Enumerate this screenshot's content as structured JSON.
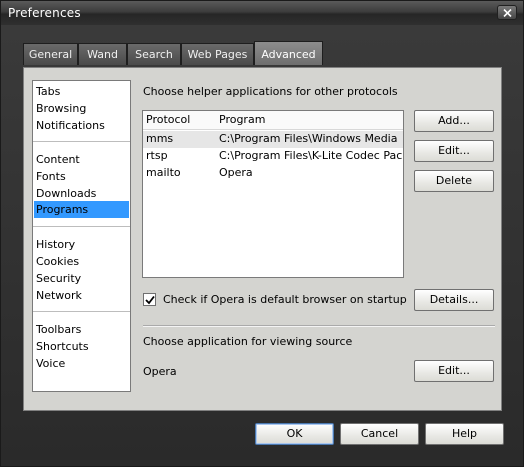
{
  "window": {
    "title": "Preferences"
  },
  "tabs": [
    {
      "label": "General"
    },
    {
      "label": "Wand"
    },
    {
      "label": "Search"
    },
    {
      "label": "Web Pages"
    },
    {
      "label": "Advanced",
      "active": true
    }
  ],
  "sidebar": {
    "groups": [
      [
        "Tabs",
        "Browsing",
        "Notifications"
      ],
      [
        "Content",
        "Fonts",
        "Downloads",
        "Programs"
      ],
      [
        "History",
        "Cookies",
        "Security",
        "Network"
      ],
      [
        "Toolbars",
        "Shortcuts",
        "Voice"
      ]
    ],
    "selected": "Programs"
  },
  "protocols": {
    "heading": "Choose helper applications for other protocols",
    "columns": [
      "Protocol",
      "Program"
    ],
    "rows": [
      {
        "protocol": "mms",
        "program": "C:\\Program Files\\Windows Media Pl...",
        "selected": true
      },
      {
        "protocol": "rtsp",
        "program": "C:\\Program Files\\K-Lite Codec Pack..."
      },
      {
        "protocol": "mailto",
        "program": "Opera"
      }
    ],
    "buttons": {
      "add": "Add...",
      "edit": "Edit...",
      "delete": "Delete"
    }
  },
  "default_browser": {
    "label": "Check if Opera is default browser on startup",
    "checked": true,
    "details_button": "Details..."
  },
  "source_viewer": {
    "heading": "Choose application for viewing source",
    "value": "Opera",
    "edit_button": "Edit..."
  },
  "dialog_buttons": {
    "ok": "OK",
    "cancel": "Cancel",
    "help": "Help"
  },
  "colors": {
    "selection": "#3399ff",
    "title_bar": "#3c3c3c",
    "panel": "#d4d4d0"
  }
}
